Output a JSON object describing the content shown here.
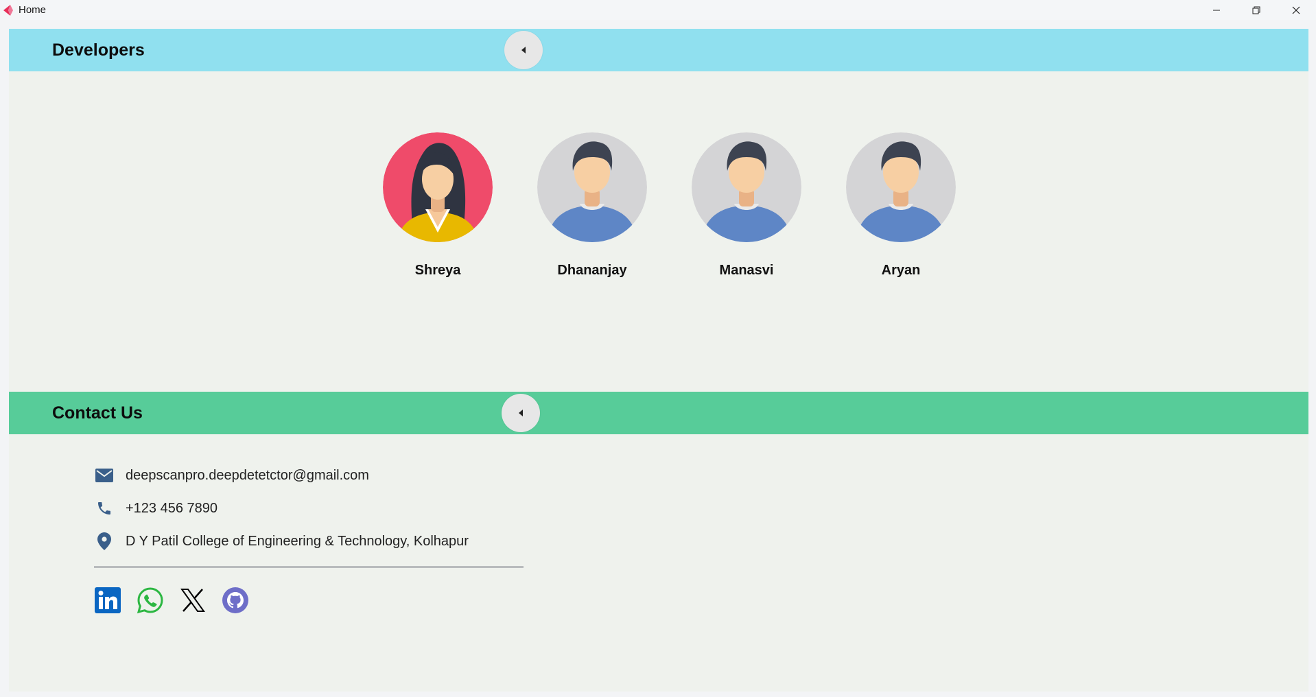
{
  "window": {
    "title": "Home",
    "icons": {
      "app": "app-logo-icon",
      "minimize": "minimize-icon",
      "restore": "restore-icon",
      "close": "close-icon"
    }
  },
  "developers": {
    "title": "Developers",
    "toggle_icon": "caret-left-icon",
    "header_color": "#90e0ef",
    "members": [
      {
        "name": "Shreya",
        "avatar": "female-avatar-icon"
      },
      {
        "name": "Dhananjay",
        "avatar": "male-avatar-icon"
      },
      {
        "name": "Manasvi",
        "avatar": "male-avatar-icon"
      },
      {
        "name": "Aryan",
        "avatar": "male-avatar-icon"
      }
    ]
  },
  "contact": {
    "title": "Contact Us",
    "toggle_icon": "caret-left-icon",
    "header_color": "#57cc99",
    "email": "deepscanpro.deepdetetctor@gmail.com",
    "phone": "+123 456 7890",
    "address": "D Y Patil College of Engineering & Technology, Kolhapur",
    "socials": [
      {
        "name": "linkedin-icon",
        "color": "#0a66c2"
      },
      {
        "name": "whatsapp-icon",
        "color": "#2cb742"
      },
      {
        "name": "x-icon",
        "color": "#000000"
      },
      {
        "name": "github-icon",
        "color": "#6e6ec8"
      }
    ]
  },
  "colors": {
    "background": "#eff2ed",
    "icon_blue": "#3a5f8a"
  }
}
